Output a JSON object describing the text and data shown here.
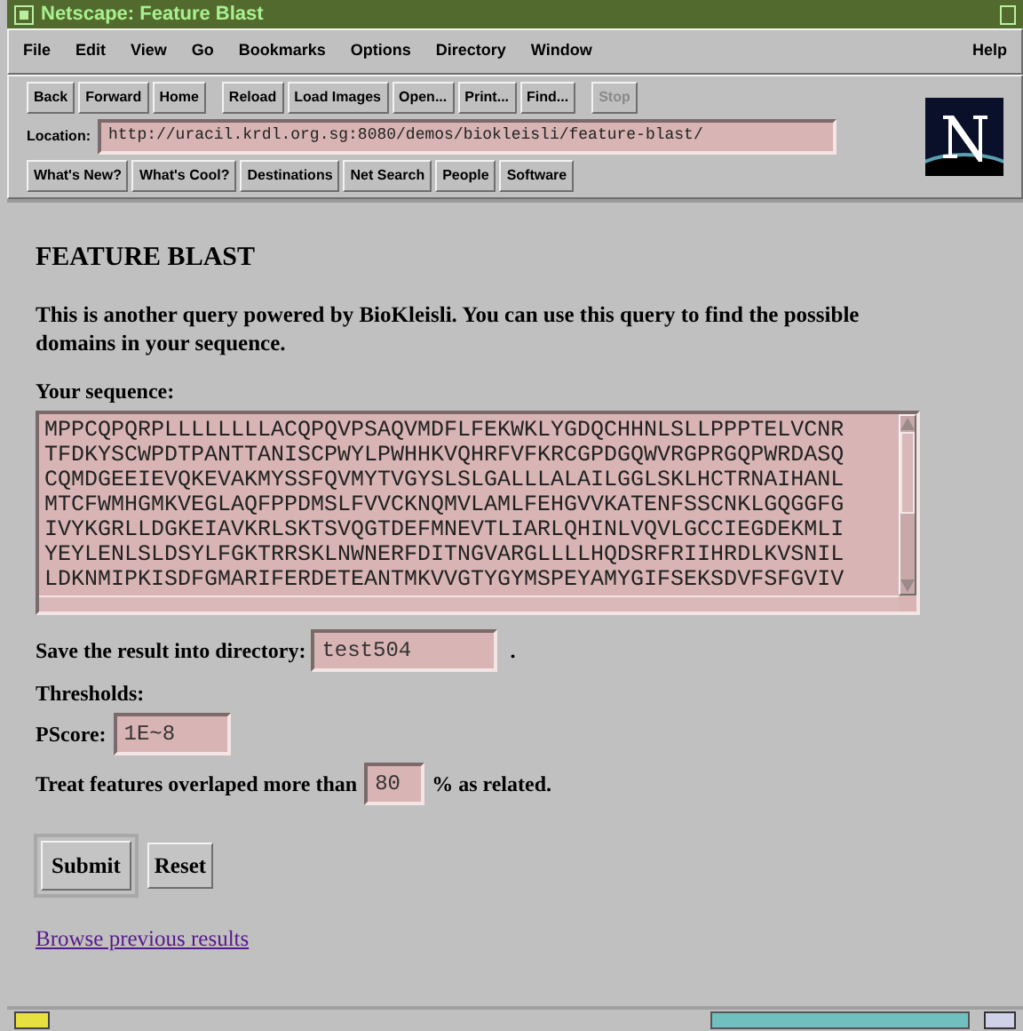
{
  "window": {
    "title": "Netscape: Feature Blast"
  },
  "menu": [
    "File",
    "Edit",
    "View",
    "Go",
    "Bookmarks",
    "Options",
    "Directory",
    "Window"
  ],
  "help_menu": "Help",
  "toolbar": [
    [
      {
        "label": "Back",
        "disabled": false
      },
      {
        "label": "Forward",
        "disabled": false
      },
      {
        "label": "Home",
        "disabled": false
      }
    ],
    [
      {
        "label": "Reload",
        "disabled": false
      },
      {
        "label": "Load Images",
        "disabled": false
      },
      {
        "label": "Open...",
        "disabled": false
      },
      {
        "label": "Print...",
        "disabled": false
      },
      {
        "label": "Find...",
        "disabled": false
      }
    ],
    [
      {
        "label": "Stop",
        "disabled": true
      }
    ]
  ],
  "location": {
    "label": "Location:",
    "value": "http://uracil.krdl.org.sg:8080/demos/biokleisli/feature-blast/"
  },
  "directory_buttons": [
    "What's New?",
    "What's Cool?",
    "Destinations",
    "Net Search",
    "People",
    "Software"
  ],
  "page": {
    "heading": "FEATURE BLAST",
    "intro": "This is another query powered by BioKleisli. You can use this query to find the possible domains in your sequence.",
    "sequence_label": "Your sequence:",
    "sequence_lines": [
      "MPPCQPQRPLLLLLLLLACQPQVPSAQVMDFLFEKWKLYGDQCHHNLSLLPPPTELVCNR",
      "TFDKYSCWPDTPANTTANISCPWYLPWHHKVQHRFVFKRCGPDGQWVRGPRGQPWRDASQ",
      "CQMDGEEIEVQKEVAKMYSSFQVMYTVGYSLSLGALLLALAILGGLSKLHCTRNAIHANL",
      "MTCFWMHGMKVEGLAQFPPDMSLFVVCKNQMVLAMLFEHGVVKATENFSSCNKLGQGGFG",
      "IVYKGRLLDGKEIAVKRLSKTSVQGTDEFMNEVTLIARLQHINLVQVLGCCIEGDEKMLI",
      "YEYLENLSLDSYLFGKTRRSKLNWNERFDITNGVARGLLLLHQDSRFRIIHRDLKVSNIL",
      "LDKNMIPKISDFGMARIFERDETEANTMKVVGTYGYMSPEYAMYGIFSEKSDVFSFGVIV"
    ],
    "save_label": "Save the result into directory:",
    "save_value": "test504",
    "save_suffix": ".",
    "thresholds_label": "Thresholds:",
    "pscore_label": "PScore:",
    "pscore_value": "1E~8",
    "overlap_label": "Treat features overlaped more than",
    "overlap_value": "80",
    "overlap_suffix": "% as related.",
    "buttons": [
      {
        "label": "Submit",
        "default": true
      },
      {
        "label": "Reset",
        "default": false
      }
    ],
    "link": {
      "label": "Browse previous results",
      "visited": true
    }
  },
  "status_bar": {
    "progress": {
      "level": 1
    }
  }
}
